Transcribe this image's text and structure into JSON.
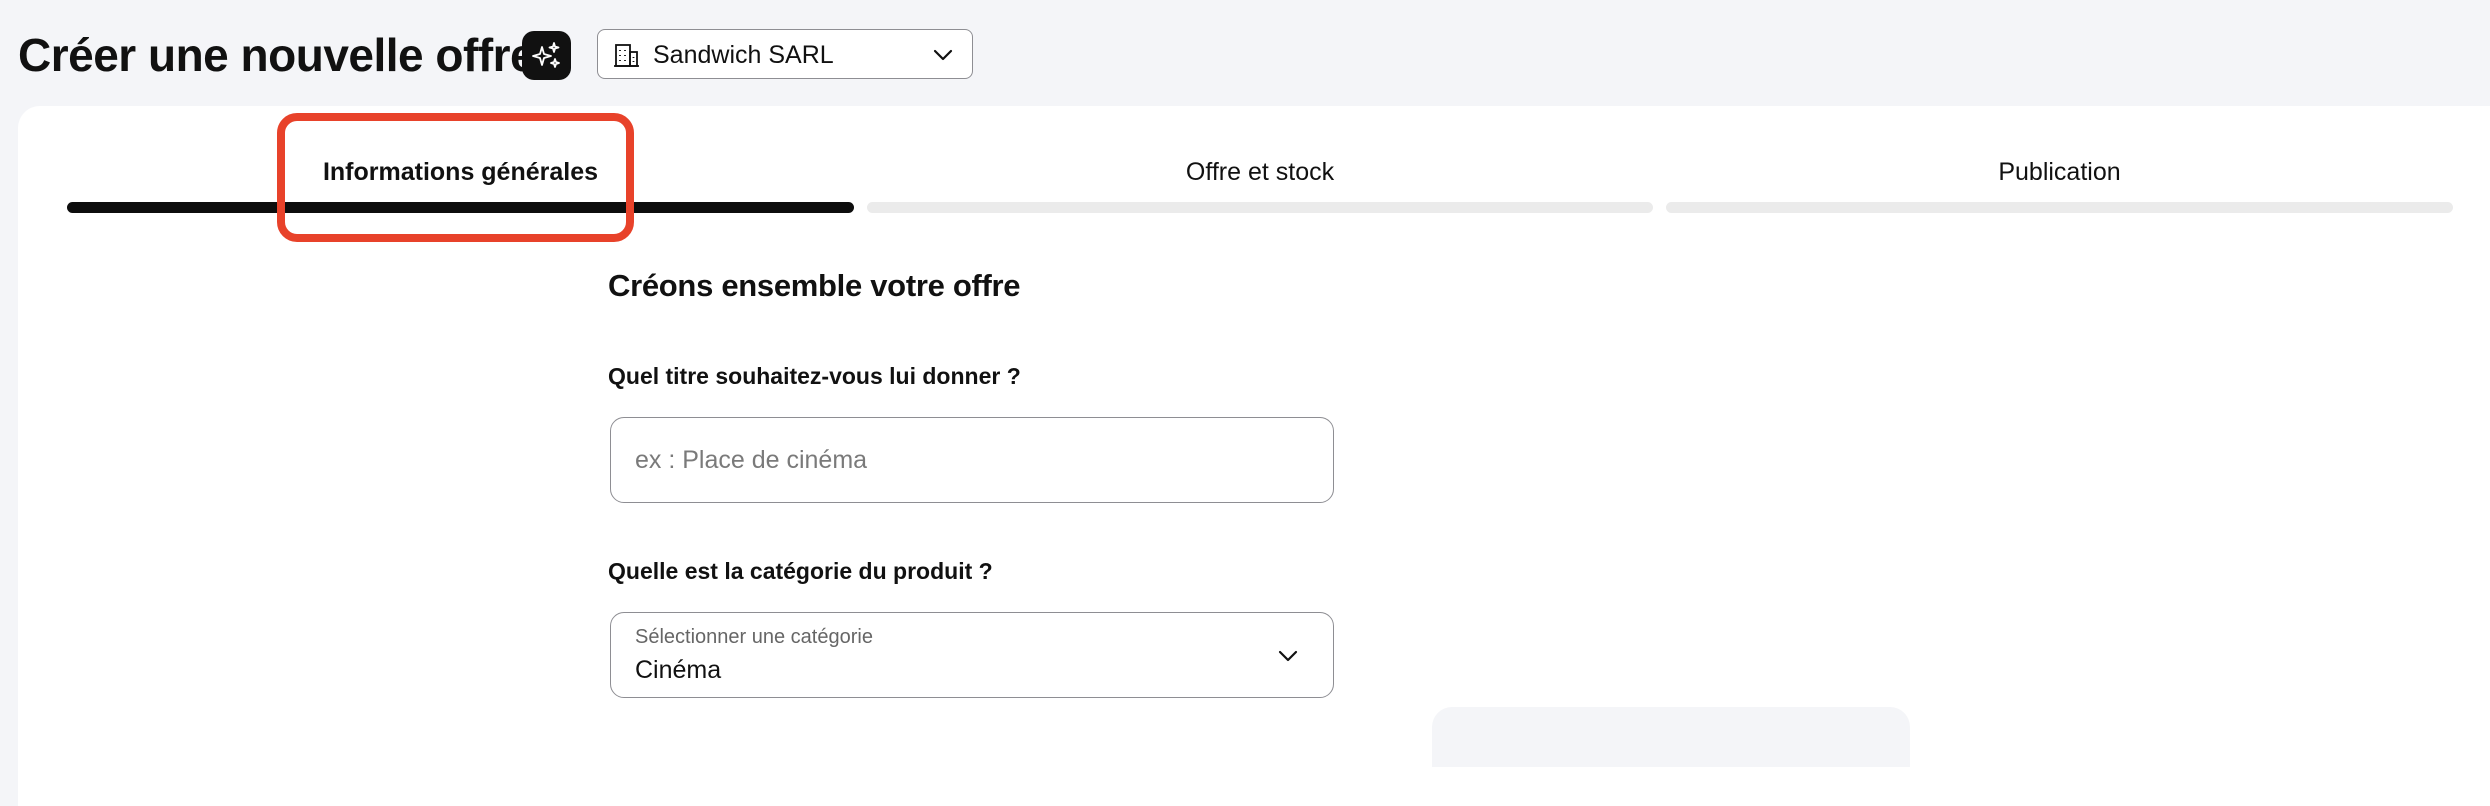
{
  "header": {
    "title": "Créer une nouvelle offre",
    "ai_icon": "sparkles-icon",
    "structure_select": {
      "icon": "building-icon",
      "value": "Sandwich SARL",
      "chevron": "chevron-down-icon"
    }
  },
  "stepper": {
    "steps": [
      {
        "label": "Informations générales",
        "active": true
      },
      {
        "label": "Offre et stock",
        "active": false
      },
      {
        "label": "Publication",
        "active": false
      }
    ],
    "active_color": "#0d0d0d",
    "inactive_color": "#ebebeb",
    "highlight_color": "#e8422a"
  },
  "form": {
    "section_title": "Créons ensemble votre offre",
    "title_field": {
      "label": "Quel titre souhaitez-vous lui donner ?",
      "value": "",
      "placeholder": "ex : Place de cinéma"
    },
    "category_field": {
      "label": "Quelle est la catégorie du produit ?",
      "hint": "Sélectionner une catégorie",
      "value": "Cinéma",
      "chevron": "chevron-down-icon"
    }
  }
}
